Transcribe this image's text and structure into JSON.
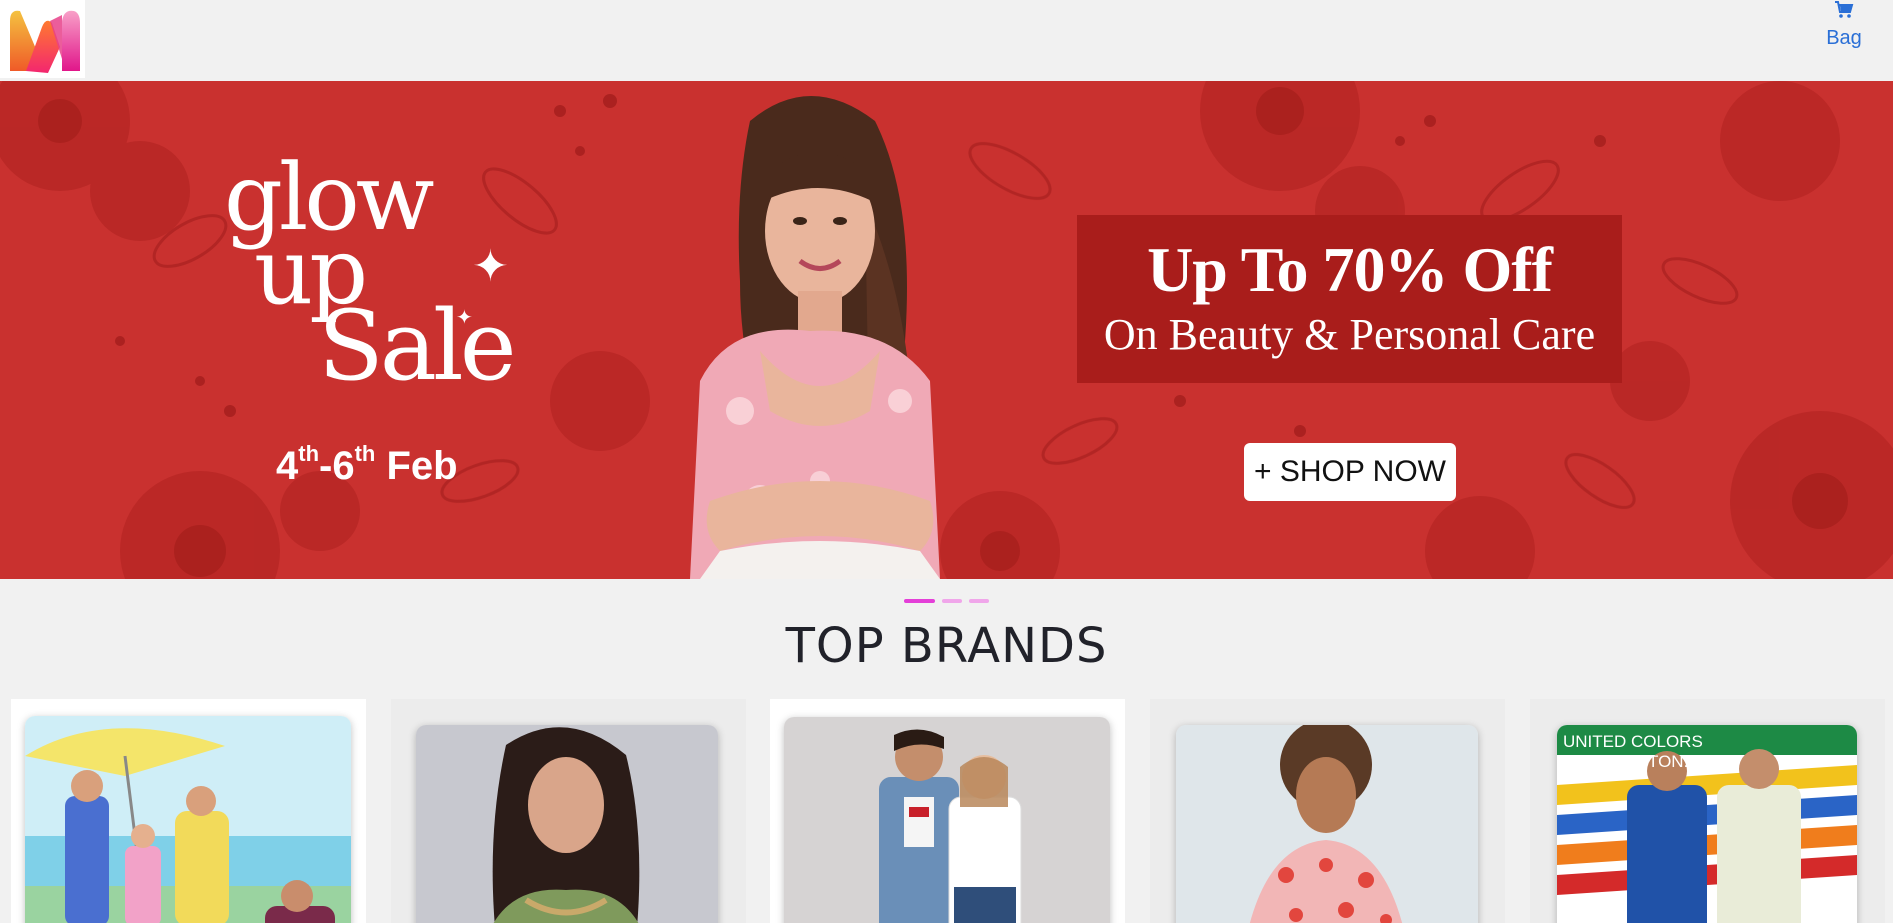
{
  "header": {
    "logo_icon": "myntra-logo-icon",
    "bag": {
      "icon": "cart-icon",
      "label": "Bag",
      "color": "#2a6fd6"
    }
  },
  "banner": {
    "background_color": "#c9312f",
    "headline": [
      "glow",
      "up",
      "Sale"
    ],
    "dates": {
      "start": "4",
      "start_suffix": "th",
      "separator": "-",
      "end": "6",
      "end_suffix": "th",
      "month": "Feb"
    },
    "offer_main": "Up To 70% Off",
    "offer_sub": "On Beauty & Personal  Care",
    "cta": "+ SHOP NOW"
  },
  "carousel": {
    "active_index": 0,
    "dot_count": 3,
    "colors": {
      "active": "#e43fd8",
      "inactive": "#f0a6ea"
    }
  },
  "top_brands": {
    "title": "TOP BRANDS",
    "cards": [
      {
        "name": "brand-card-1",
        "logo_text": ""
      },
      {
        "name": "brand-card-2",
        "logo_text": ""
      },
      {
        "name": "brand-card-3",
        "logo_text": ""
      },
      {
        "name": "brand-card-4",
        "logo_text": ""
      },
      {
        "name": "brand-card-5",
        "logo_text": "UNITED COLORS OF BENETTON."
      }
    ]
  }
}
